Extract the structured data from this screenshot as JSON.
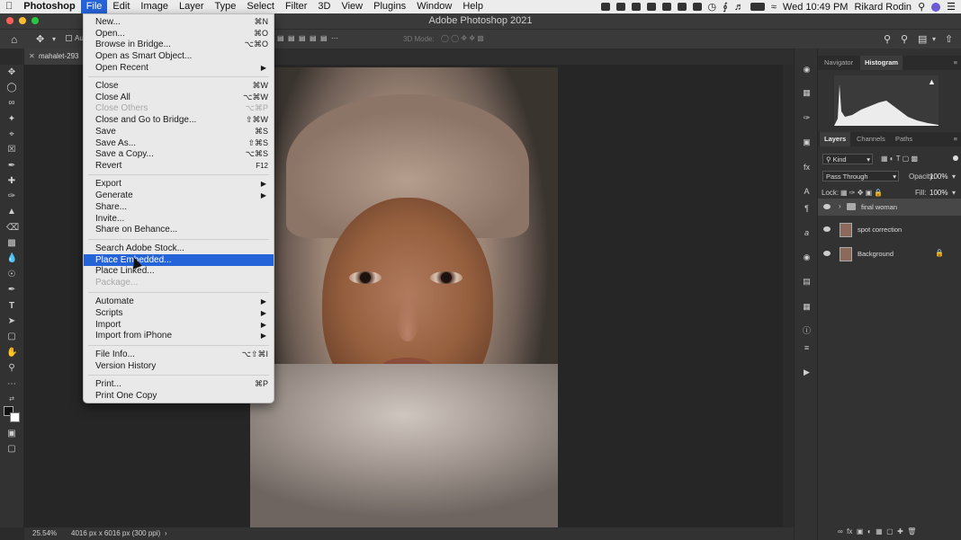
{
  "menubar": {
    "app": "Photoshop",
    "items": [
      "File",
      "Edit",
      "Image",
      "Layer",
      "Type",
      "Select",
      "Filter",
      "3D",
      "View",
      "Plugins",
      "Window",
      "Help"
    ],
    "clock": "Wed 10:49 PM",
    "user": "Rikard Rodin"
  },
  "window": {
    "title": "Adobe Photoshop 2021"
  },
  "document": {
    "tab": "mahalet-293"
  },
  "status": {
    "zoom": "25.54%",
    "dimensions": "4016 px x 6016 px (300 ppi)"
  },
  "panels": {
    "top_tabs": [
      "Navigator",
      "Histogram"
    ],
    "layer_tabs": [
      "Layers",
      "Channels",
      "Paths"
    ],
    "filter": "Kind",
    "blend_mode": "Pass Through",
    "opacity_label": "Opacity:",
    "opacity": "100%",
    "lock_label": "Lock:",
    "fill_label": "Fill:",
    "fill": "100%",
    "layers": [
      {
        "name": "final woman"
      },
      {
        "name": "spot correction"
      },
      {
        "name": "Background"
      }
    ]
  },
  "optbar": {
    "auto": "Au",
    "mode3d": "3D Mode:"
  },
  "file_menu": {
    "items": [
      {
        "label": "New...",
        "shortcut": "⌘N"
      },
      {
        "label": "Open...",
        "shortcut": "⌘O"
      },
      {
        "label": "Browse in Bridge...",
        "shortcut": "⌥⌘O"
      },
      {
        "label": "Open as Smart Object...",
        "shortcut": ""
      },
      {
        "label": "Open Recent",
        "shortcut": ""
      },
      {
        "label": "Close",
        "shortcut": "⌘W"
      },
      {
        "label": "Close All",
        "shortcut": "⌥⌘W"
      },
      {
        "label": "Close Others",
        "shortcut": "⌥⌘P"
      },
      {
        "label": "Close and Go to Bridge...",
        "shortcut": "⇧⌘W"
      },
      {
        "label": "Save",
        "shortcut": "⌘S"
      },
      {
        "label": "Save As...",
        "shortcut": "⇧⌘S"
      },
      {
        "label": "Save a Copy...",
        "shortcut": "⌥⌘S"
      },
      {
        "label": "Revert",
        "shortcut": "F12"
      },
      {
        "label": "Export",
        "shortcut": ""
      },
      {
        "label": "Generate",
        "shortcut": ""
      },
      {
        "label": "Share...",
        "shortcut": ""
      },
      {
        "label": "Invite...",
        "shortcut": ""
      },
      {
        "label": "Share on Behance...",
        "shortcut": ""
      },
      {
        "label": "Search Adobe Stock...",
        "shortcut": ""
      },
      {
        "label": "Place Embedded...",
        "shortcut": ""
      },
      {
        "label": "Place Linked...",
        "shortcut": ""
      },
      {
        "label": "Package...",
        "shortcut": ""
      },
      {
        "label": "Automate",
        "shortcut": ""
      },
      {
        "label": "Scripts",
        "shortcut": ""
      },
      {
        "label": "Import",
        "shortcut": ""
      },
      {
        "label": "Import from iPhone",
        "shortcut": ""
      },
      {
        "label": "File Info...",
        "shortcut": "⌥⇧⌘I"
      },
      {
        "label": "Version History",
        "shortcut": ""
      },
      {
        "label": "Print...",
        "shortcut": "⌘P"
      },
      {
        "label": "Print One Copy",
        "shortcut": ""
      }
    ]
  }
}
